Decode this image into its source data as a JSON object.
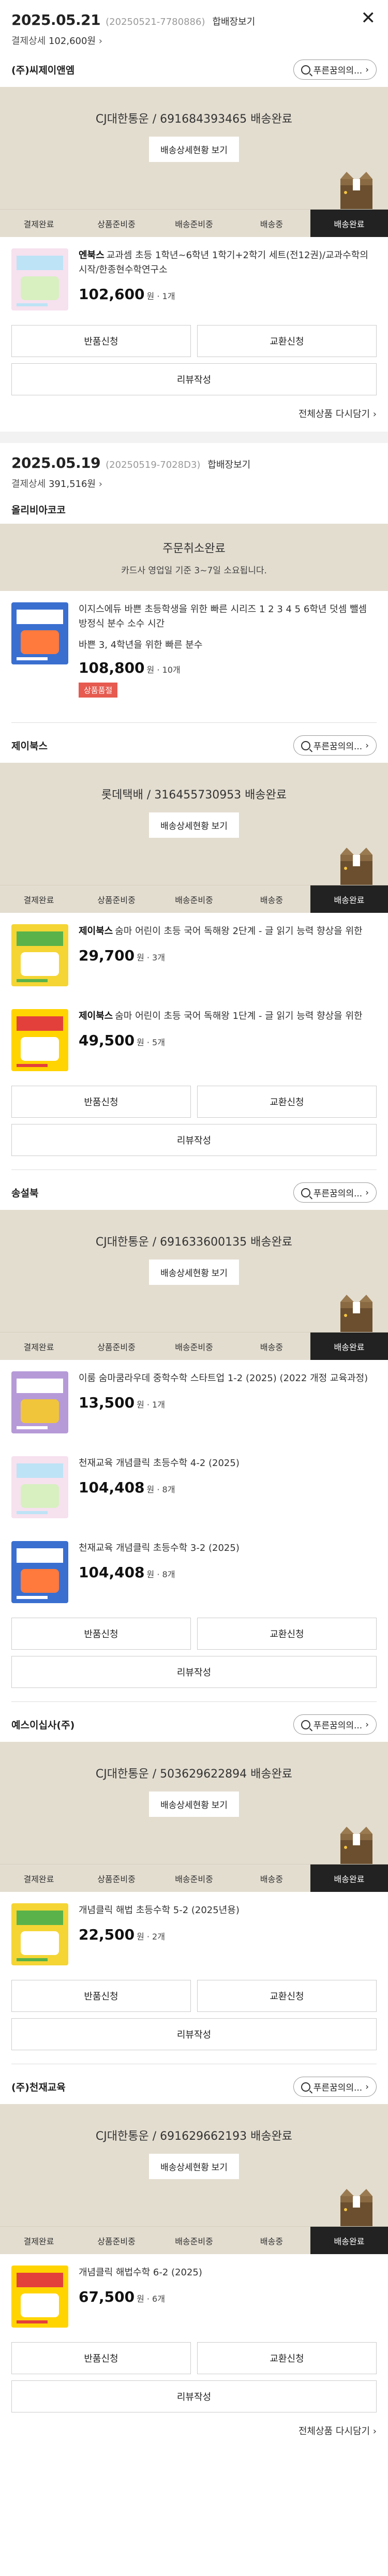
{
  "orders": [
    {
      "date": "2025.05.21",
      "no": "(20250521-7780886)",
      "combine": "합배장보기",
      "pay_label": "결제상세",
      "pay_amount": "102,600원",
      "sellers": [
        {
          "name": "(주)씨제이앤엠",
          "inquiry": "푸른꿈의의...",
          "ship_text": "CJ대한통운 / 691684393465 배송완료",
          "ship_btn": "배송상세현황 보기",
          "steps": [
            "결제완료",
            "상품준비중",
            "배송준비중",
            "배송중",
            "배송완료"
          ],
          "items": [
            {
              "brand": "엔북스",
              "name": "교과셈 초등 1학년~6학년 1학기+2학기 세트(전12권)/교과수학의시작/한종현수학연구소",
              "price": "102,600",
              "qty": "원 · 1개"
            }
          ],
          "btn_return": "반품신청",
          "btn_exchange": "교환신청",
          "btn_review": "리뷰작성"
        }
      ],
      "reorder": "전체상품 다시담기"
    },
    {
      "date": "2025.05.19",
      "no": "(20250519-7028D3)",
      "combine": "합배장보기",
      "pay_label": "결제상세",
      "pay_amount": "391,516원",
      "cancel_seller": "올리비아코코",
      "cancel_title": "주문취소완료",
      "cancel_sub": "카드사 영업일 기준 3~7일 소요됩니다.",
      "cancel_item": {
        "name": "이지스에듀 바쁜 초등학생을 위한 빠른 시리즈 1 2 3 4 5 6학년 덧셈 뺄셈 방정식 분수 소수 시간",
        "option": "바쁜 3, 4학년을 위한 빠른 분수",
        "price": "108,800",
        "qty": "원 · 10개",
        "tag": "상품품절"
      },
      "sellers": [
        {
          "name": "제이북스",
          "inquiry": "푸른꿈의의...",
          "ship_text": "롯데택배 / 316455730953 배송완료",
          "ship_btn": "배송상세현황 보기",
          "steps": [
            "결제완료",
            "상품준비중",
            "배송준비중",
            "배송중",
            "배송완료"
          ],
          "items": [
            {
              "brand": "제이북스",
              "name": "숨마 어린이 초등 국어 독해왕 2단계 - 글 읽기 능력 향상을 위한",
              "price": "29,700",
              "qty": "원 · 3개"
            },
            {
              "brand": "제이북스",
              "name": "숨마 어린이 초등 국어 독해왕 1단계 - 글 읽기 능력 향상을 위한",
              "price": "49,500",
              "qty": "원 · 5개"
            }
          ],
          "btn_return": "반품신청",
          "btn_exchange": "교환신청",
          "btn_review": "리뷰작성"
        },
        {
          "name": "송설북",
          "inquiry": "푸른꿈의의...",
          "ship_text": "CJ대한통운 / 691633600135 배송완료",
          "ship_btn": "배송상세현황 보기",
          "steps": [
            "결제완료",
            "상품준비중",
            "배송준비중",
            "배송중",
            "배송완료"
          ],
          "items": [
            {
              "brand": "",
              "name": "이룸 숨마쿰라우데 중학수학 스타트업 1-2 (2025) (2022 개정 교육과정)",
              "price": "13,500",
              "qty": "원 · 1개"
            },
            {
              "brand": "",
              "name": "천재교육 개념클릭 초등수학 4-2 (2025)",
              "price": "104,408",
              "qty": "원 · 8개"
            },
            {
              "brand": "",
              "name": "천재교육 개념클릭 초등수학 3-2 (2025)",
              "price": "104,408",
              "qty": "원 · 8개"
            }
          ],
          "btn_return": "반품신청",
          "btn_exchange": "교환신청",
          "btn_review": "리뷰작성"
        },
        {
          "name": "예스이십사(주)",
          "inquiry": "푸른꿈의의...",
          "ship_text": "CJ대한통운 / 503629622894 배송완료",
          "ship_btn": "배송상세현황 보기",
          "steps": [
            "결제완료",
            "상품준비중",
            "배송준비중",
            "배송중",
            "배송완료"
          ],
          "items": [
            {
              "brand": "",
              "name": "개념클릭 해법 초등수학 5-2 (2025년용)",
              "price": "22,500",
              "qty": "원 · 2개"
            }
          ],
          "btn_return": "반품신청",
          "btn_exchange": "교환신청",
          "btn_review": "리뷰작성"
        },
        {
          "name": "(주)천재교육",
          "inquiry": "푸른꿈의의...",
          "ship_text": "CJ대한통운 / 691629662193 배송완료",
          "ship_btn": "배송상세현황 보기",
          "steps": [
            "결제완료",
            "상품준비중",
            "배송준비중",
            "배송중",
            "배송완료"
          ],
          "items": [
            {
              "brand": "",
              "name": "개념클릭 해법수학 6-2 (2025)",
              "price": "67,500",
              "qty": "원 · 6개"
            }
          ],
          "btn_return": "반품신청",
          "btn_exchange": "교환신청",
          "btn_review": "리뷰작성"
        }
      ],
      "reorder": "전체상품 다시담기"
    }
  ],
  "colors": {
    "ship_bg": "#e3ddd0",
    "active_step": "#222222",
    "soldout_tag": "#e65a4f"
  },
  "icons": {
    "close": "close-icon",
    "inquiry": "search-icon",
    "box": "delivered-box-icon",
    "chevron": "chevron-right-icon"
  }
}
